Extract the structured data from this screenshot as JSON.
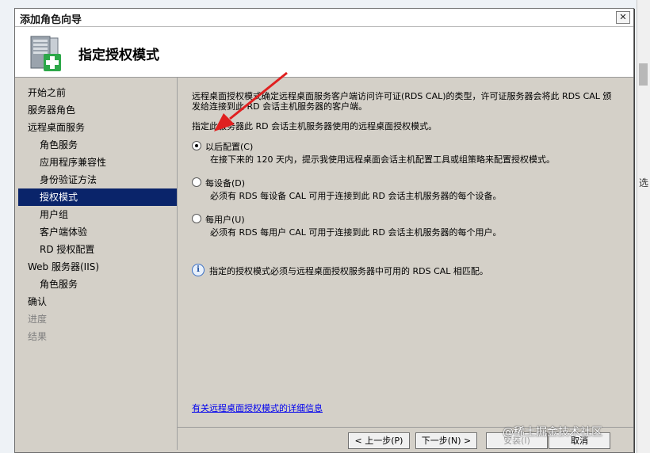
{
  "window": {
    "title": "添加角色向导",
    "close_label": "✕"
  },
  "header": {
    "page_title": "指定授权模式",
    "icon": "server-add-icon"
  },
  "sidebar": {
    "items": [
      {
        "label": "开始之前",
        "level": 0,
        "state": "normal"
      },
      {
        "label": "服务器角色",
        "level": 0,
        "state": "normal"
      },
      {
        "label": "远程桌面服务",
        "level": 0,
        "state": "normal"
      },
      {
        "label": "角色服务",
        "level": 1,
        "state": "normal"
      },
      {
        "label": "应用程序兼容性",
        "level": 1,
        "state": "normal"
      },
      {
        "label": "身份验证方法",
        "level": 1,
        "state": "normal"
      },
      {
        "label": "授权模式",
        "level": 1,
        "state": "active"
      },
      {
        "label": "用户组",
        "level": 1,
        "state": "normal"
      },
      {
        "label": "客户端体验",
        "level": 1,
        "state": "normal"
      },
      {
        "label": "RD 授权配置",
        "level": 1,
        "state": "normal"
      },
      {
        "label": "Web 服务器(IIS)",
        "level": 0,
        "state": "normal"
      },
      {
        "label": "角色服务",
        "level": 1,
        "state": "normal"
      },
      {
        "label": "确认",
        "level": 0,
        "state": "normal"
      },
      {
        "label": "进度",
        "level": 0,
        "state": "disabled"
      },
      {
        "label": "结果",
        "level": 0,
        "state": "disabled"
      }
    ]
  },
  "content": {
    "intro": "远程桌面授权模式确定远程桌面服务客户端访问许可证(RDS CAL)的类型，许可证服务器会将此 RDS CAL 颁发给连接到此 RD 会话主机服务器的客户端。",
    "prompt": "指定此服务器此 RD 会话主机服务器使用的远程桌面授权模式。",
    "options": [
      {
        "label": "以后配置(C)",
        "description": "在接下来的 120 天内，提示我使用远程桌面会话主机配置工具或组策略来配置授权模式。",
        "checked": true
      },
      {
        "label": "每设备(D)",
        "description": "必须有 RDS 每设备 CAL 可用于连接到此 RD 会话主机服务器的每个设备。",
        "checked": false
      },
      {
        "label": "每用户(U)",
        "description": "必须有 RDS 每用户 CAL 可用于连接到此 RD 会话主机服务器的每个用户。",
        "checked": false
      }
    ],
    "info_text": "指定的授权模式必须与远程桌面授权服务器中可用的 RDS CAL 相匹配。",
    "more_info_link": "有关远程桌面授权模式的详细信息"
  },
  "buttons": {
    "back": "< 上一步(P)",
    "next": "下一步(N) >",
    "install": "安装(I)",
    "cancel": "取消"
  },
  "overlay": {
    "watermark": "@稀土掘金技术社区",
    "edge_char": "选",
    "arrow_color": "#e02020"
  }
}
